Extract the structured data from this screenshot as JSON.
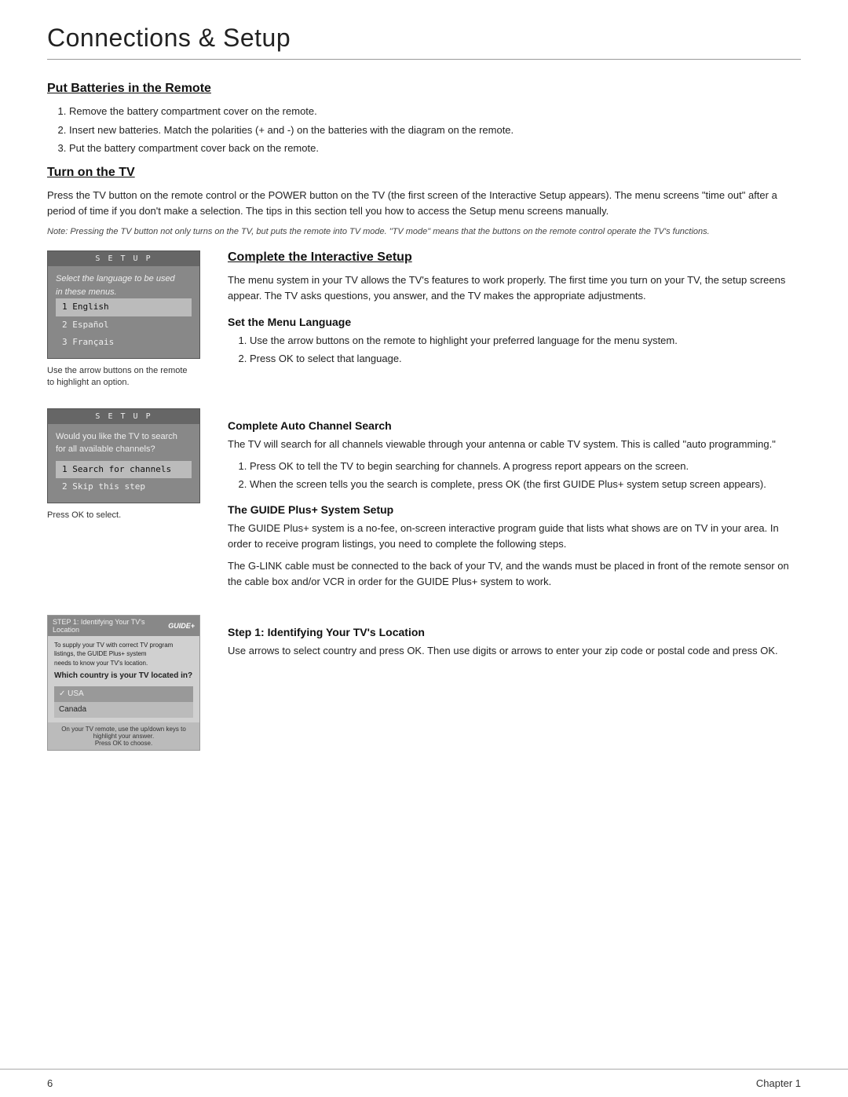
{
  "page": {
    "title": "Connections & Setup",
    "footer_left": "6",
    "footer_right": "Chapter 1"
  },
  "batteries_section": {
    "heading": "Put Batteries in the Remote",
    "steps": [
      "Remove the battery compartment cover on the remote.",
      "Insert new batteries. Match the polarities (+ and -) on the batteries with the diagram on the remote.",
      "Put the battery compartment cover back on the remote."
    ]
  },
  "turn_on_section": {
    "heading": "Turn on the TV",
    "body": "Press the TV button on the remote control or the POWER button on the TV (the first screen of the Interactive Setup appears). The menu screens \"time out\" after a period of time if you don't make a selection. The tips in this section tell you how to access the Setup menu screens manually.",
    "note": "Note: Pressing the TV button not only turns on the TV, but puts the remote into TV mode. \"TV mode\" means that the buttons on the remote control operate the TV's functions."
  },
  "interactive_setup": {
    "heading": "Complete the Interactive Setup",
    "body": "The menu system in your TV allows the TV's features to work properly. The first time you turn on your TV, the setup screens appear. The TV asks questions, you answer, and the TV makes the appropriate adjustments.",
    "setup_screen_1": {
      "title": "S E T U P",
      "body_text": "Select the language to be used\nin these menus.",
      "menu_items": [
        {
          "label": "1 English",
          "selected": true
        },
        {
          "label": "2 Español",
          "selected": false
        },
        {
          "label": "3 Français",
          "selected": false
        }
      ],
      "caption": "Use the arrow buttons on the remote\nto highlight an option."
    },
    "set_menu_language": {
      "subheading": "Set the Menu Language",
      "steps": [
        "Use the arrow buttons on the remote to highlight your preferred language for the menu system.",
        "Press OK to select that language."
      ]
    },
    "setup_screen_2": {
      "title": "S E T U P",
      "body_text": "Would you like the TV to search\nfor all available channels?",
      "menu_items": [
        {
          "label": "1 Search for channels",
          "selected": true
        },
        {
          "label": "2 Skip this step",
          "selected": false
        }
      ],
      "caption": "Press OK to select."
    },
    "auto_channel": {
      "subheading": "Complete Auto Channel Search",
      "body1": "The TV will search for all channels viewable through your antenna or cable TV system. This is called \"auto programming.\"",
      "steps": [
        "Press OK to tell the TV to begin searching for channels. A progress report appears on the screen.",
        "When the screen tells you the search is complete, press OK (the first GUIDE Plus+ system setup screen appears)."
      ]
    },
    "guide_plus": {
      "subheading": "The GUIDE Plus+ System Setup",
      "body1": "The GUIDE Plus+ system is a no-fee, on-screen interactive program guide that lists what shows are on TV in your area. In order to receive program listings, you need to complete the following steps.",
      "body2": "The G-LINK cable must be connected to the back of your TV, and the wands must be placed in front of the remote sensor on the cable box and/or VCR in order for the GUIDE Plus+ system to work."
    },
    "guide_screen": {
      "header_left": "STEP 1: Identifying Your TV's Location",
      "header_right": "GUIDE+",
      "supply_text": "To supply your TV with correct TV program listings, the GUIDE Plus+ system\nneeds to know your TV's location.",
      "question": "Which country is your TV located in?",
      "options": [
        {
          "label": "✓ USA",
          "selected": true
        },
        {
          "label": "Canada",
          "selected": false
        }
      ],
      "footer": "On your TV remote, use the up/down keys to highlight your answer.\nPress OK to choose."
    },
    "step1": {
      "subheading": "Step 1: Identifying Your TV's Location",
      "body": "Use arrows to select country and press OK. Then use digits or arrows to enter your zip code or postal code and press OK."
    }
  }
}
